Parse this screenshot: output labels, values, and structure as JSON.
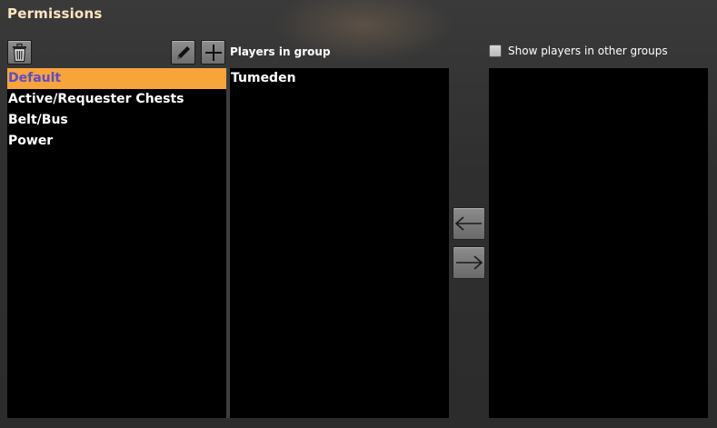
{
  "window": {
    "title": "Permissions"
  },
  "toolbar": {
    "delete_icon": "trash-icon",
    "edit_icon": "pencil-icon",
    "add_icon": "plus-icon"
  },
  "groups": {
    "items": [
      {
        "label": "Default",
        "selected": true
      },
      {
        "label": "Active/Requester Chests",
        "selected": false
      },
      {
        "label": "Belt/Bus",
        "selected": false
      },
      {
        "label": "Power",
        "selected": false
      }
    ]
  },
  "players_in_group": {
    "header": "Players in group",
    "items": [
      "Tumeden"
    ]
  },
  "other_groups": {
    "checkbox_label": "Show players in other groups",
    "checked": false,
    "items": []
  },
  "transfer": {
    "left_icon": "arrow-left-icon",
    "right_icon": "arrow-right-icon"
  },
  "colors": {
    "selected_bg": "#f7a43a",
    "selected_text": "#5c4ccf",
    "title": "#ffe6c0"
  }
}
